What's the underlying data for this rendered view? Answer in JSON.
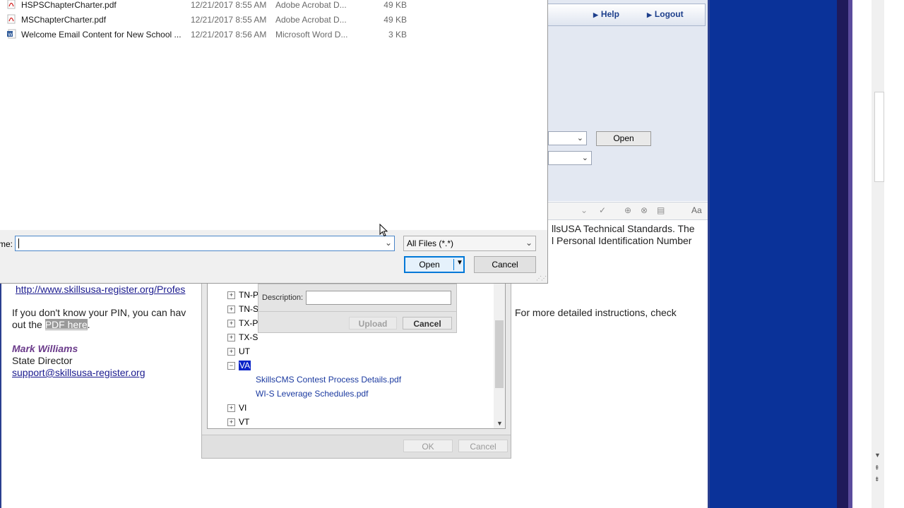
{
  "header": {
    "help_label": "Help",
    "logout_label": "Logout"
  },
  "background_page": {
    "open_button_label": "Open",
    "editor_aa_label": "Aa",
    "text_line1": "llsUSA Technical Standards.  The",
    "text_line2": "l Personal Identification Number",
    "url_text": "http://www.skillsusa-register.org/Profes",
    "pin_line_part1": "If you don't know your PIN, you can hav",
    "pin_line_part2": "For more detailed instructions, check",
    "out_the": "out the",
    "pdf_link": "PDF here",
    "period": ".",
    "signature_name": "Mark Williams",
    "signature_title": "State Director",
    "support_email": "support@skillsusa-register.org"
  },
  "file_dialog": {
    "files": [
      {
        "name": "HSPSChapterCharter.pdf",
        "date": "12/21/2017 8:55 AM",
        "type": "Adobe Acrobat D...",
        "size": "49 KB",
        "icon": "pdf-icon"
      },
      {
        "name": "MSChapterCharter.pdf",
        "date": "12/21/2017 8:55 AM",
        "type": "Adobe Acrobat D...",
        "size": "49 KB",
        "icon": "pdf-icon"
      },
      {
        "name": "Welcome Email Content for New School ...",
        "date": "12/21/2017 8:56 AM",
        "type": "Microsoft Word D...",
        "size": "3 KB",
        "icon": "word-doc-icon"
      }
    ],
    "filename_label": "me:",
    "filename_value": "",
    "filetype_value": "All Files (*.*)",
    "open_label": "Open",
    "cancel_label": "Cancel"
  },
  "tree_dialog": {
    "nodes": [
      {
        "label": "TN-P",
        "expanded": false
      },
      {
        "label": "TN-S",
        "expanded": false
      },
      {
        "label": "TX-P",
        "expanded": false
      },
      {
        "label": "TX-S",
        "expanded": false
      },
      {
        "label": "UT",
        "expanded": false
      },
      {
        "label": "VA",
        "expanded": true,
        "selected": true
      },
      {
        "label": "VI",
        "expanded": false
      },
      {
        "label": "VT",
        "expanded": false
      }
    ],
    "va_files": [
      "SkillsCMS Contest Process Details.pdf",
      "WI-S Leverage Schedules.pdf"
    ],
    "ok_label": "OK",
    "cancel_label": "Cancel"
  },
  "upload_panel": {
    "description_label": "Description:",
    "upload_label": "Upload",
    "cancel_label": "Cancel"
  }
}
